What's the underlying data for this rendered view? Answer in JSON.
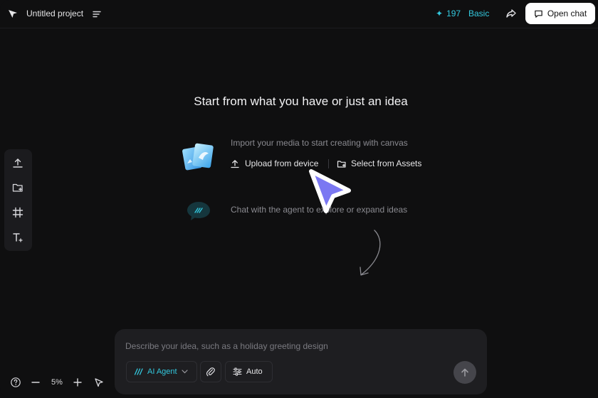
{
  "header": {
    "project_title": "Untitled project",
    "credits": "197",
    "credits_icon": "✦",
    "plan": "Basic",
    "open_chat_label": "Open chat",
    "accent_color": "#33c8de"
  },
  "main": {
    "headline": "Start from what you have or just an idea",
    "import_text": "Import your media to start creating with canvas",
    "upload_label": "Upload from device",
    "assets_label": "Select from Assets",
    "chat_text": "Chat with the agent to explore or expand ideas"
  },
  "left_toolbar": {
    "icons": [
      "upload-icon",
      "folder-add-icon",
      "frame-icon",
      "text-add-icon"
    ]
  },
  "bottom_controls": {
    "zoom": "5%"
  },
  "prompt": {
    "placeholder": "Describe your idea, such as a holiday greeting design",
    "value": "",
    "agent_label": "AI Agent",
    "auto_label": "Auto"
  }
}
